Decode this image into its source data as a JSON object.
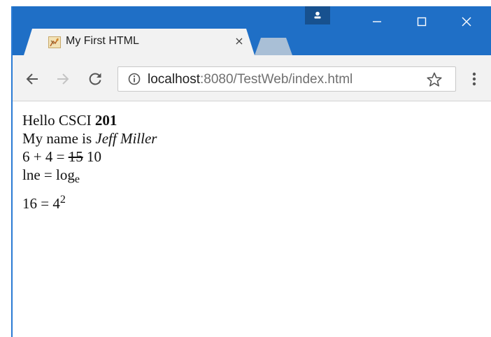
{
  "window": {
    "controls": {
      "minimize_icon": "minimize-icon",
      "maximize_icon": "maximize-icon",
      "close_icon": "close-icon"
    },
    "profile_icon": "person-icon"
  },
  "tab": {
    "title": "My First HTML",
    "close_glyph": "×",
    "favicon": "html-favicon"
  },
  "toolbar": {
    "back_icon": "arrow-left-icon",
    "forward_icon": "arrow-right-icon",
    "reload_icon": "reload-icon",
    "url_host": "localhost",
    "url_rest": ":8080/TestWeb/index.html",
    "bookmark_icon": "star-icon",
    "menu_icon": "more-vertical-icon"
  },
  "content": {
    "line1_text": "Hello CSCI ",
    "line1_bold": "201",
    "line2_text": "My name is ",
    "line2_italic": "Jeff Miller",
    "line3_text": "6 + 4 = ",
    "line3_strike": "15",
    "line3_after": " 10",
    "line4_text": "lne = log",
    "line4_sub": "e",
    "line5_text": "16 = 4",
    "line5_sup": "2"
  },
  "colors": {
    "titlebar": "#1f6fc6",
    "tab_background": "#f2f2f2",
    "inactive_tab": "#a9bfd6",
    "url_muted": "#707070"
  }
}
